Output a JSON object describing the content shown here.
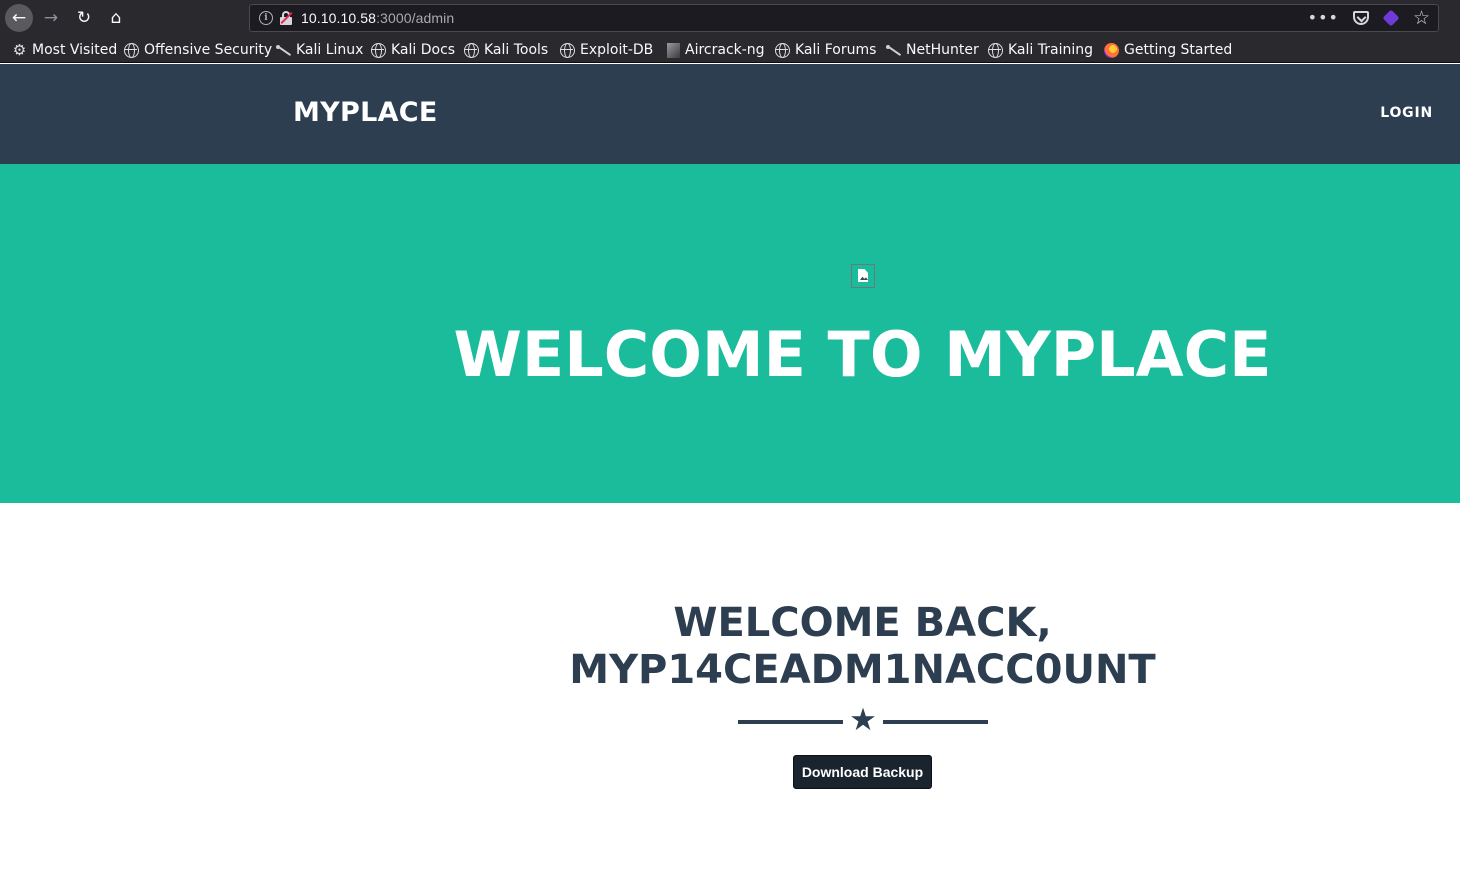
{
  "browser": {
    "url_host": "10.10.10.58",
    "url_path": ":3000/admin",
    "icons": [
      "back-icon",
      "forward-icon",
      "reload-icon",
      "home-icon",
      "info-icon",
      "insecure-lock-icon",
      "more-icon",
      "pocket-icon",
      "extension-icon",
      "bookmark-star-icon"
    ],
    "bookmarks": [
      {
        "label": "Most Visited",
        "icon": "gear-icon"
      },
      {
        "label": "Offensive Security",
        "icon": "globe-icon"
      },
      {
        "label": "Kali Linux",
        "icon": "kali-dragon-icon"
      },
      {
        "label": "Kali Docs",
        "icon": "globe-icon"
      },
      {
        "label": "Kali Tools",
        "icon": "globe-icon"
      },
      {
        "label": "Exploit-DB",
        "icon": "globe-icon"
      },
      {
        "label": "Aircrack-ng",
        "icon": "aircrack-icon"
      },
      {
        "label": "Kali Forums",
        "icon": "globe-icon"
      },
      {
        "label": "NetHunter",
        "icon": "kali-dragon-icon"
      },
      {
        "label": "Kali Training",
        "icon": "globe-icon"
      },
      {
        "label": "Getting Started",
        "icon": "firefox-icon"
      }
    ]
  },
  "site": {
    "brand": "MYPLACE",
    "nav_login": "LOGIN",
    "hero_title": "WELCOME TO MYPLACE",
    "welcome_line1": "WELCOME BACK,",
    "welcome_line2": "MYP14CEADM1NACC0UNT",
    "download_label": "Download Backup"
  },
  "colors": {
    "navbar": "#2c3e50",
    "hero": "#1abc9c",
    "button": "#1a242e",
    "heading": "#2c3e50"
  }
}
